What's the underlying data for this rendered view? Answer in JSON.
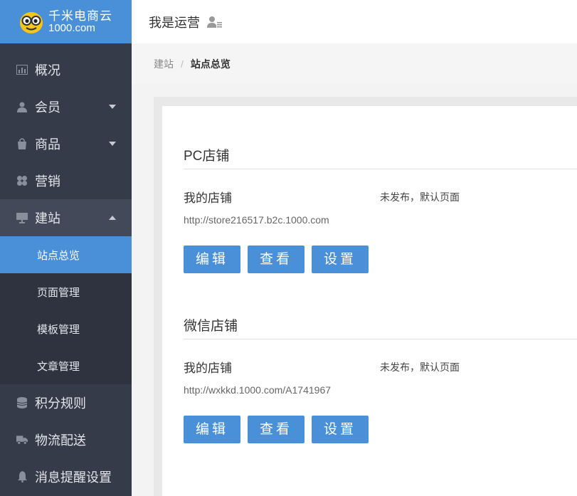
{
  "brand": {
    "name": "千米电商云",
    "domain": "1000.com",
    "colors": {
      "primary": "#4a90d9",
      "sidebar": "#363b49"
    }
  },
  "sidebar": {
    "items": [
      {
        "label": "概况",
        "icon": "chart-icon"
      },
      {
        "label": "会员",
        "icon": "user-icon",
        "expandable": true
      },
      {
        "label": "商品",
        "icon": "bag-icon",
        "expandable": true
      },
      {
        "label": "营销",
        "icon": "marketing-icon"
      },
      {
        "label": "建站",
        "icon": "monitor-icon",
        "expanded": true,
        "children": [
          {
            "label": "站点总览",
            "active": true
          },
          {
            "label": "页面管理"
          },
          {
            "label": "模板管理"
          },
          {
            "label": "文章管理"
          }
        ]
      },
      {
        "label": "积分规则",
        "icon": "coins-icon"
      },
      {
        "label": "物流配送",
        "icon": "truck-icon"
      },
      {
        "label": "消息提醒设置",
        "icon": "bell-icon"
      }
    ]
  },
  "header": {
    "title": "我是运营",
    "switch_icon": "user-switch-icon"
  },
  "breadcrumb": {
    "parent": "建站",
    "separator": "/",
    "current": "站点总览"
  },
  "sections": [
    {
      "title": "PC店铺",
      "store_name": "我的店铺",
      "status": "未发布，默认页面",
      "url": "http://store216517.b2c.1000.com",
      "buttons": [
        "编辑",
        "查看",
        "设置"
      ]
    },
    {
      "title": "微信店铺",
      "store_name": "我的店铺",
      "status": "未发布，默认页面",
      "url": "http://wxkkd.1000.com/A1741967",
      "buttons": [
        "编辑",
        "查看",
        "设置"
      ]
    }
  ]
}
